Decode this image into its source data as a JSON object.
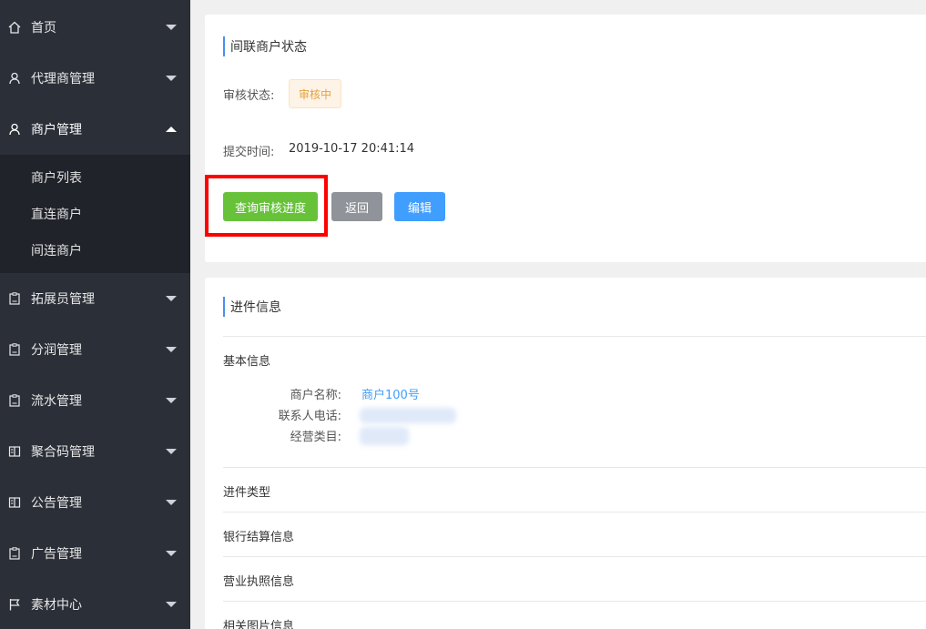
{
  "sidebar": {
    "items": [
      {
        "label": "首页",
        "icon": "home-icon"
      },
      {
        "label": "代理商管理",
        "icon": "user-icon"
      },
      {
        "label": "商户管理",
        "icon": "user-icon"
      },
      {
        "label": "拓展员管理",
        "icon": "clipboard-icon"
      },
      {
        "label": "分润管理",
        "icon": "clipboard-icon"
      },
      {
        "label": "流水管理",
        "icon": "clipboard-icon"
      },
      {
        "label": "聚合码管理",
        "icon": "book-icon"
      },
      {
        "label": "公告管理",
        "icon": "book-icon"
      },
      {
        "label": "广告管理",
        "icon": "clipboard-icon"
      },
      {
        "label": "素材中心",
        "icon": "flag-icon"
      }
    ],
    "submenu": [
      "商户列表",
      "直连商户",
      "间连商户"
    ]
  },
  "status_panel": {
    "title": "间联商户状态",
    "review_status_label": "审核状态:",
    "review_status_value": "审核中",
    "submit_time_label": "提交时间:",
    "submit_time_value": "2019-10-17 20:41:14",
    "buttons": {
      "query": "查询审核进度",
      "back": "返回",
      "edit": "编辑"
    }
  },
  "info_panel": {
    "title": "进件信息",
    "basic_info_title": "基本信息",
    "fields": {
      "merchant_name_label": "商户名称:",
      "merchant_name_value": "商户100号",
      "contact_phone_label": "联系人电话:",
      "business_category_label": "经营类目:"
    },
    "sections": [
      "进件类型",
      "银行结算信息",
      "营业执照信息",
      "相关图片信息"
    ]
  },
  "colors": {
    "sidebar_bg": "#2b2f38",
    "submenu_bg": "#20232a",
    "accent_blue": "#409eff",
    "success_green": "#67c23a",
    "warning_orange": "#e6a23c",
    "highlight_red": "#ff0000"
  }
}
